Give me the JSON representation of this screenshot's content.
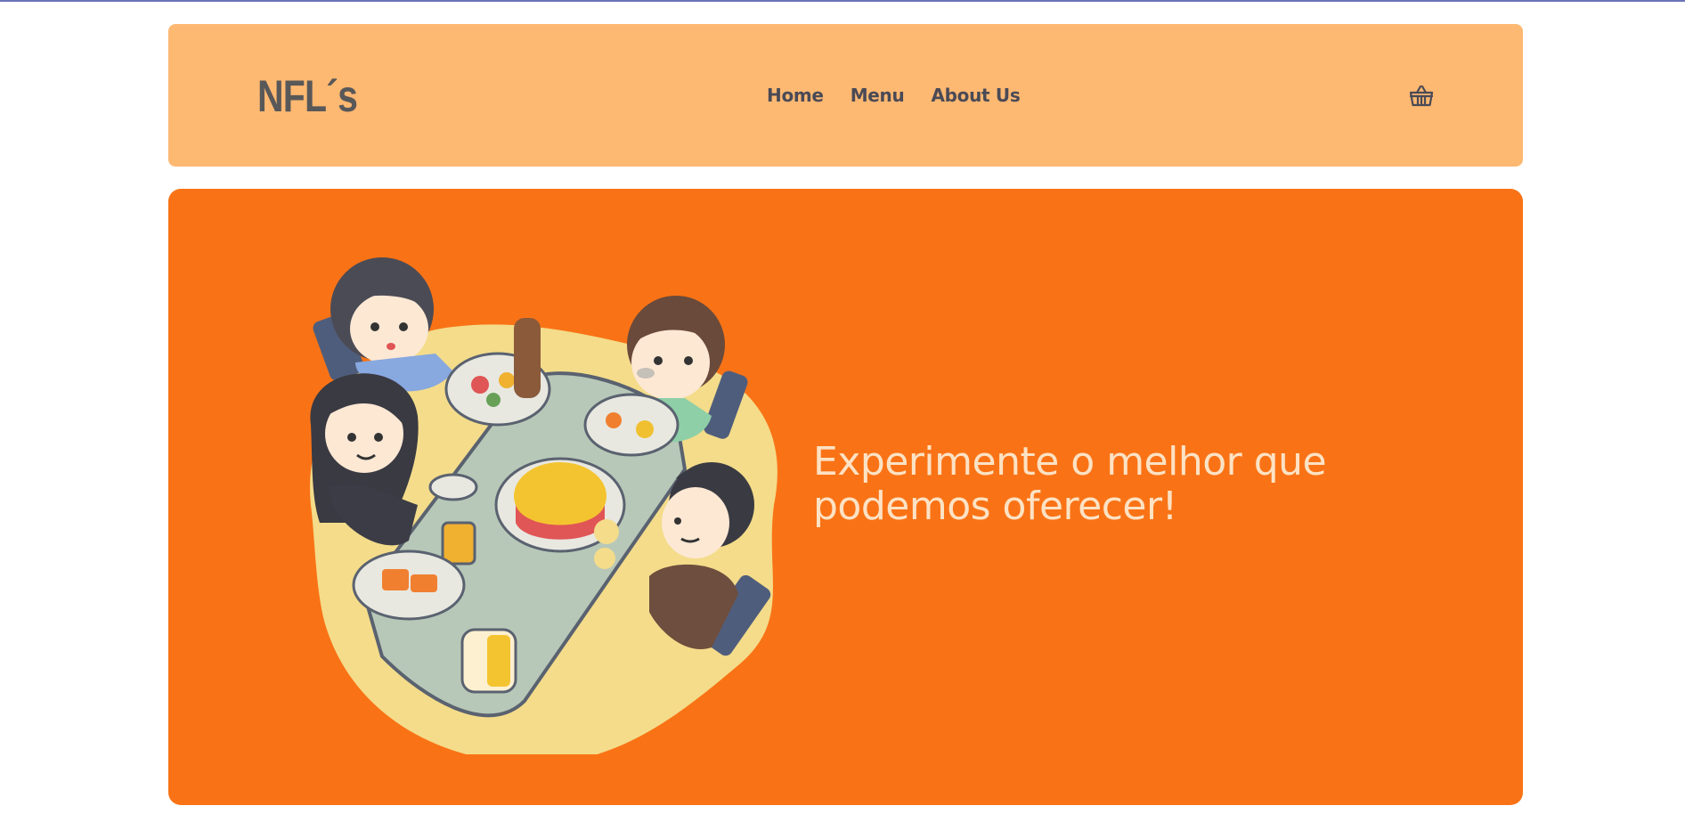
{
  "header": {
    "logo": "NFL´s",
    "nav": [
      {
        "label": "Home"
      },
      {
        "label": "Menu"
      },
      {
        "label": "About Us"
      }
    ],
    "cart_icon": "basket-icon"
  },
  "hero": {
    "title": "Experimente o melhor que podemos oferecer!",
    "illustration": "friends-sharing-meal-illustration"
  },
  "colors": {
    "top_line": "#6b74b8",
    "header_bg": "#fdb872",
    "hero_bg": "#f97316",
    "hero_text": "#fde2c4",
    "text_dark": "#4a4a56"
  }
}
